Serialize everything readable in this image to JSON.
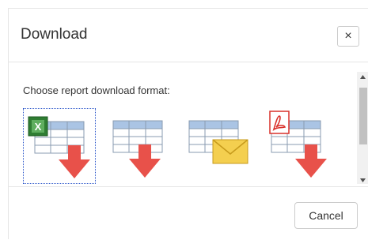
{
  "dialog": {
    "title": "Download",
    "close_label": "×",
    "prompt": "Choose report download format:",
    "formats": [
      {
        "icon": "excel-download-icon",
        "selected": true
      },
      {
        "icon": "csv-download-icon",
        "selected": false
      },
      {
        "icon": "email-report-icon",
        "selected": false
      },
      {
        "icon": "pdf-download-icon",
        "selected": false
      }
    ],
    "cancel_label": "Cancel"
  },
  "colors": {
    "arrow": "#e8514a",
    "table_header": "#aac4e4",
    "excel_green": "#2f7d32",
    "envelope": "#f4cf4f",
    "pdf_red": "#d9302a",
    "focus_border": "#2a55c9"
  }
}
